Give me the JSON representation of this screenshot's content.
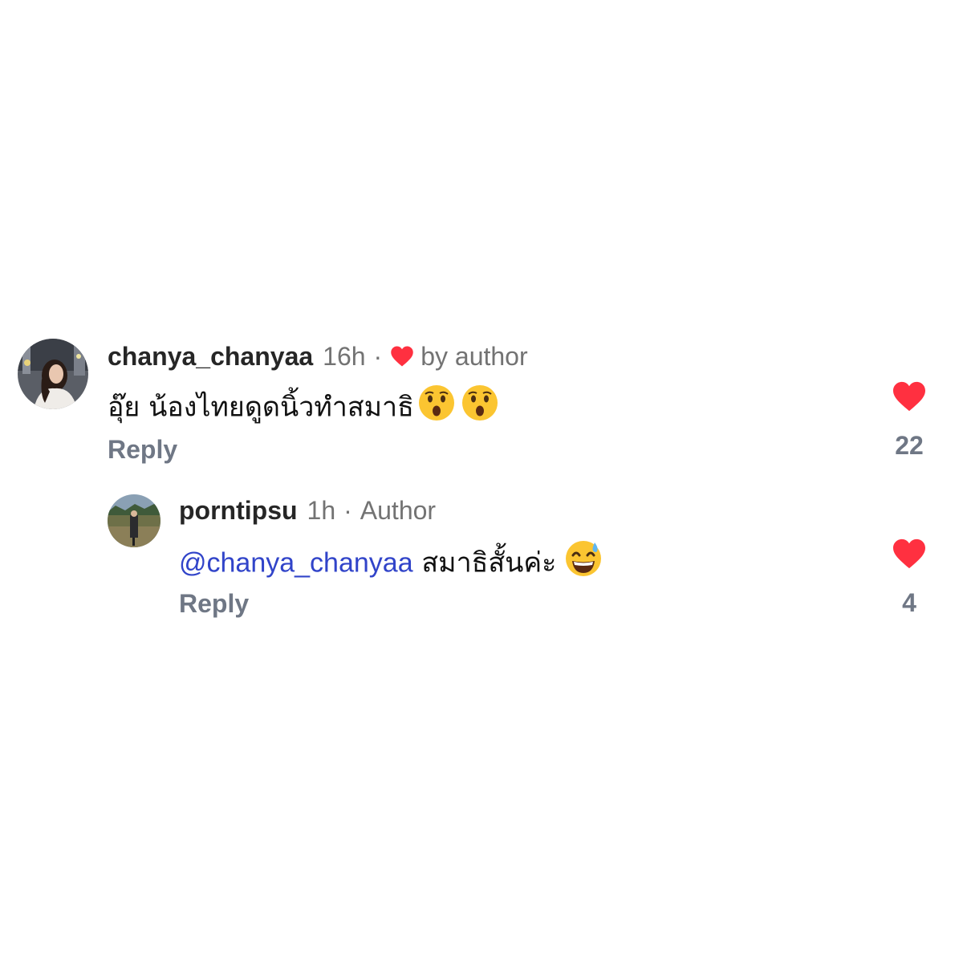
{
  "comments": [
    {
      "username": "chanya_chanyaa",
      "time": "16h",
      "separator": "·",
      "badge_icon": "heart-icon",
      "badge": "by author",
      "text": "อุ๊ย น้องไทยดูดนิ้วทำสมาธิ",
      "emojis": [
        "astonished-face",
        "astonished-face"
      ],
      "reply_label": "Reply",
      "likes": "22",
      "like_icon": "heart-icon",
      "like_color": "#ff3040"
    }
  ],
  "replies": [
    {
      "username": "porntipsu",
      "time": "1h",
      "separator": "·",
      "badge": "Author",
      "mention": "@chanya_chanyaa",
      "text": " สมาธิสั้นค่ะ",
      "emojis": [
        "grinning-face-with-sweat"
      ],
      "reply_label": "Reply",
      "likes": "4",
      "like_icon": "heart-icon",
      "like_color": "#ff3040"
    }
  ],
  "colors": {
    "username": "#262626",
    "meta": "#737373",
    "mention": "#3144c9",
    "heart": "#ff3040"
  }
}
